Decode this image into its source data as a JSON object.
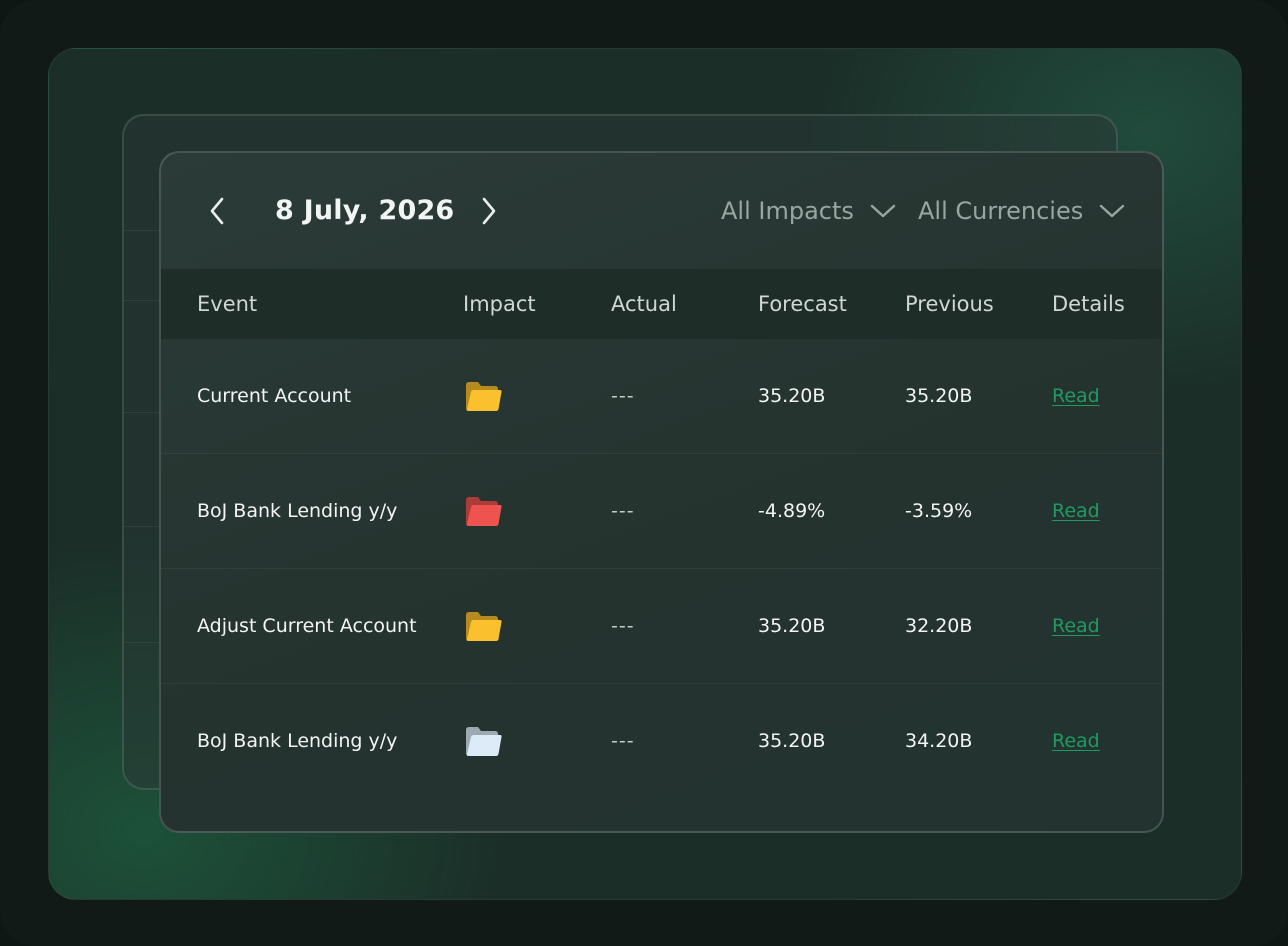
{
  "calendar": {
    "date": "8 July, 2026",
    "filters": [
      {
        "label": "All Impacts"
      },
      {
        "label": "All Currencies"
      }
    ],
    "columns": [
      "Event",
      "Impact",
      "Actual",
      "Forecast",
      "Previous",
      "Details"
    ],
    "rows": [
      {
        "event": "Current Account",
        "impact": "medium",
        "actual": "---",
        "forecast": "35.20B",
        "previous": "35.20B",
        "details": "Read"
      },
      {
        "event": "BoJ Bank Lending y/y",
        "impact": "high",
        "actual": "---",
        "forecast": "-4.89%",
        "previous": "-3.59%",
        "details": "Read"
      },
      {
        "event": "Adjust Current Account",
        "impact": "medium",
        "actual": "---",
        "forecast": "35.20B",
        "previous": "32.20B",
        "details": "Read"
      },
      {
        "event": "BoJ Bank Lending y/y",
        "impact": "low",
        "actual": "---",
        "forecast": "35.20B",
        "previous": "34.20B",
        "details": "Read"
      }
    ]
  },
  "impact_colors": {
    "high": "#ef5350",
    "medium": "#fbc02d",
    "low": "#dcebf7"
  },
  "icons": {
    "prev": "chevron-left-icon",
    "next": "chevron-right-icon",
    "dropdown": "chevron-down-icon",
    "impact": "folder-icon"
  }
}
